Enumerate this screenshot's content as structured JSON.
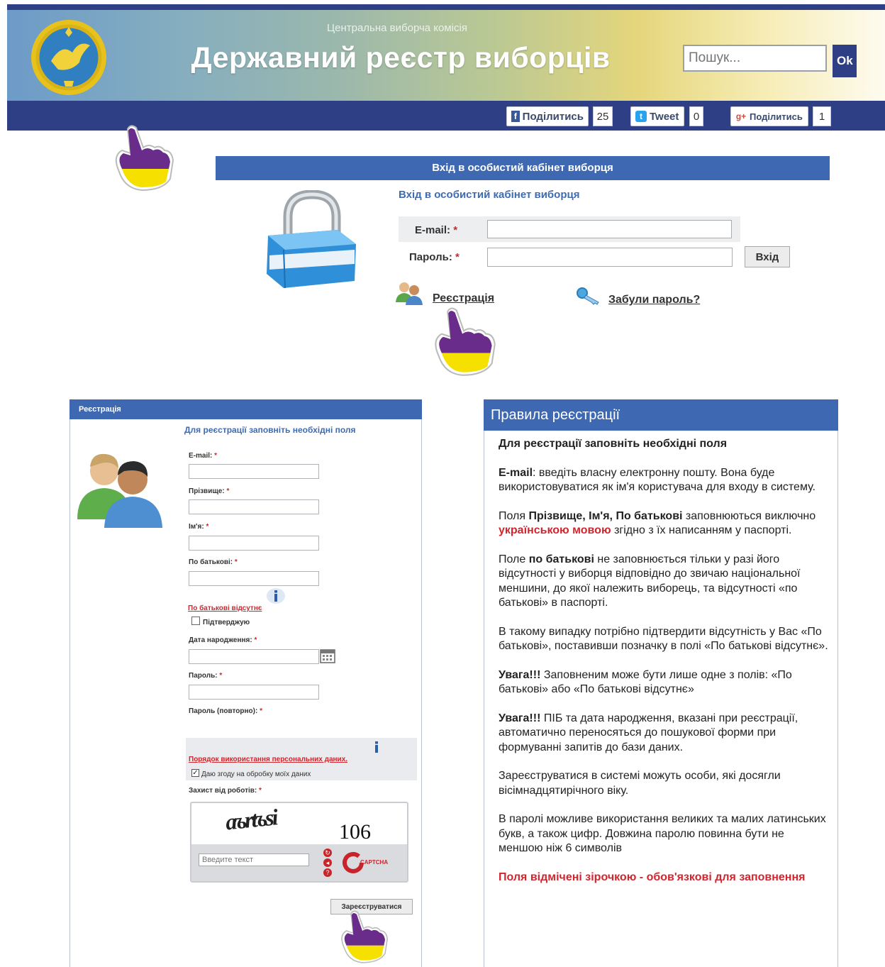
{
  "header": {
    "commission_name": "Центральна виборча комісія",
    "title": "Державний реєстр виборців",
    "search_placeholder": "Пошук...",
    "search_button": "Ok"
  },
  "social": {
    "facebook_label": "Поділитись",
    "facebook_count": "25",
    "twitter_label": "Tweet",
    "twitter_count": "0",
    "gplus_label": "Поділитись",
    "gplus_count": "1"
  },
  "login": {
    "header": "Вхід в особистий кабінет виборця",
    "subtitle": "Вхід в особистий кабінет виборця",
    "email_label": "E-mail:",
    "password_label": "Пароль:",
    "required_mark": "*",
    "submit": "Вхід",
    "register_link": "Реєстрація",
    "forgot_link": "Забули пароль?"
  },
  "registration": {
    "header": "Реєстрація",
    "subtitle": "Для реєстрації заповніть необхідні поля",
    "email_label": "E-mail:",
    "surname_label": "Прізвище:",
    "name_label": "Ім'я:",
    "patronymic_label": "По батькові:",
    "patronymic_absent_link": "По батькові відсутнє",
    "confirm_label": "Підтверджую",
    "birthdate_label": "Дата народження:",
    "password_label": "Пароль:",
    "password_repeat_label": "Пароль (повторно):",
    "personal_data_link": "Порядок використання персональних даних.",
    "consent_label": "Даю згоду на обробку моїх даних",
    "captcha_label": "Захист від роботів:",
    "captcha_distorted": "aъrtъsi",
    "captcha_number": "106",
    "captcha_placeholder": "Введите текст",
    "captcha_brand": "CAPTCHA",
    "submit": "Зареєструватися"
  },
  "rules": {
    "header": "Правила реєстрації",
    "heading": "Для реєстрації заповніть необхідні поля",
    "p1_bold": "E-mail",
    "p1_text": ": введіть власну електронну пошту. Вона буде використовуватися як ім'я користувача для входу в систему.",
    "p2_a": "Поля ",
    "p2_bold": "Прізвище, Ім'я, По батькові",
    "p2_b": " заповнюються виключно ",
    "p2_red": "українською мовою",
    "p2_c": " згідно з їх написанням у паспорті.",
    "p3_a": "Поле ",
    "p3_bold": "по батькові",
    "p3_b": " не заповнюється тільки у разі його відсутності у виборця відповідно до звичаю національної меншини, до якої належить виборець, та відсутності «по батькові» в паспорті.",
    "p4": "В такому випадку потрібно підтвердити відсутність у Вас «По батькові», поставивши позначку в полі «По батькові відсутнє».",
    "p5_bold": "Увага!!!",
    "p5_text": " Заповненим може бути лише одне з полів: «По батькові» або «По батькові відсутнє»",
    "p6_bold": "Увага!!!",
    "p6_text": " ПІБ та дата народження, вказані при реєстрації, автоматично переносяться до пошукової форми при формуванні запитів до бази даних.",
    "p7": "Зареєструватися в системі можуть особи, які досягли вісімнадцятирічного віку.",
    "p8": "В паролі можливе використання великих та малих латинських букв, а також цифр. Довжина паролю повинна бути не меншою ніж 6 символів",
    "required_note": "Поля відмічені зірочкою - обов'язкові для заповнення"
  }
}
